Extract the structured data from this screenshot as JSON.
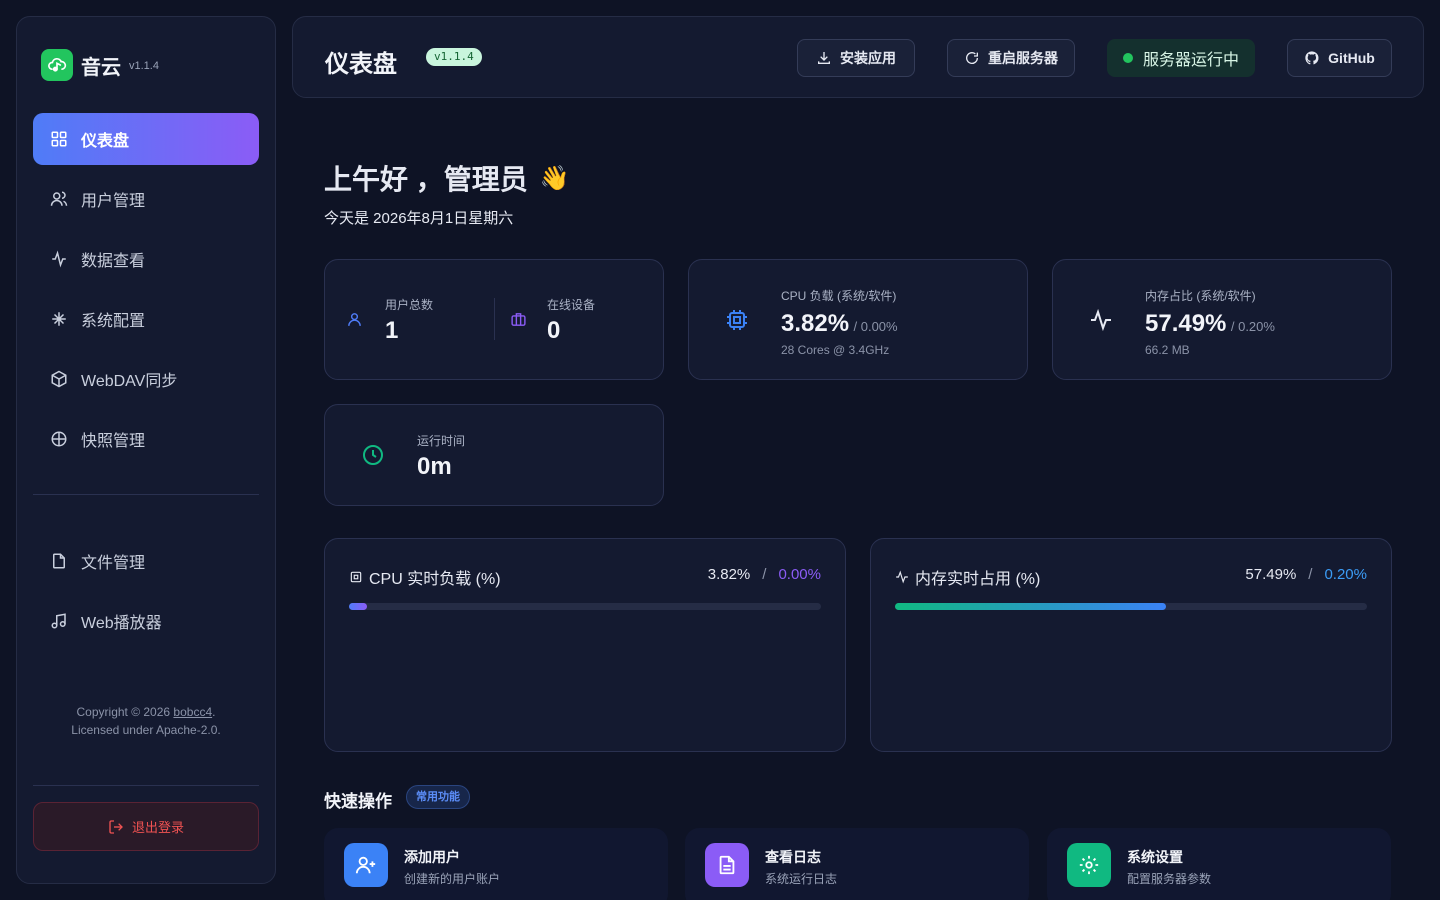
{
  "sidebar": {
    "brand": {
      "name": "音云",
      "version": "v1.1.4"
    },
    "nav": [
      {
        "label": "仪表盘",
        "icon": "dashboard-icon",
        "active": true
      },
      {
        "label": "用户管理",
        "icon": "users-icon"
      },
      {
        "label": "数据查看",
        "icon": "activity-icon"
      },
      {
        "label": "系统配置",
        "icon": "sparkle-icon"
      },
      {
        "label": "WebDAV同步",
        "icon": "package-icon"
      },
      {
        "label": "快照管理",
        "icon": "plus-circle-icon"
      }
    ],
    "nav2": [
      {
        "label": "文件管理",
        "icon": "file-icon"
      },
      {
        "label": "Web播放器",
        "icon": "music-icon"
      }
    ],
    "copyright_prefix": "Copyright © 2026 ",
    "copyright_link": "bobcc4",
    "copyright_suffix": ".",
    "license": "Licensed under Apache-2.0.",
    "logout": "退出登录"
  },
  "header": {
    "title": "仪表盘",
    "version": "v1.1.4",
    "install_btn": "安装应用",
    "restart_btn": "重启服务器",
    "status": "服务器运行中",
    "github_btn": "GitHub"
  },
  "greeting": {
    "text": "上午好 ，管理员",
    "emoji": "👋",
    "date": "今天是 2026年8月1日星期六"
  },
  "stats": {
    "users": {
      "label": "用户总数",
      "value": "1"
    },
    "devices": {
      "label": "在线设备",
      "value": "0"
    },
    "cpu": {
      "label": "CPU 负载 (系统/软件)",
      "value": "3.82%",
      "sub": "/ 0.00%",
      "detail": "28 Cores @ 3.4GHz"
    },
    "memory": {
      "label": "内存占比 (系统/软件)",
      "value": "57.49%",
      "sub": "/ 0.20%",
      "detail": "66.2 MB"
    },
    "uptime": {
      "label": "运行时间",
      "value": "0m"
    }
  },
  "charts": {
    "cpu": {
      "title": "CPU 实时负载 (%)",
      "system": "3.82%",
      "sep": "/",
      "app": "0.00%",
      "fill": 0.0382
    },
    "memory": {
      "title": "内存实时占用 (%)",
      "system": "57.49%",
      "sep": "/",
      "app": "0.20%",
      "fill": 0.5749
    }
  },
  "quick": {
    "title": "快速操作",
    "badge": "常用功能",
    "items": [
      {
        "name": "添加用户",
        "desc": "创建新的用户账户",
        "icon": "user-plus-icon",
        "color": "#3b82f6"
      },
      {
        "name": "查看日志",
        "desc": "系统运行日志",
        "icon": "file-text-icon",
        "color": "#8b5cf6"
      },
      {
        "name": "系统设置",
        "desc": "配置服务器参数",
        "icon": "settings-icon",
        "color": "#10b981"
      }
    ]
  },
  "colors": {
    "accent_blue": "#4f7cf7",
    "accent_purple": "#8b5cf6",
    "success": "#22c55e",
    "danger": "#f05252"
  }
}
